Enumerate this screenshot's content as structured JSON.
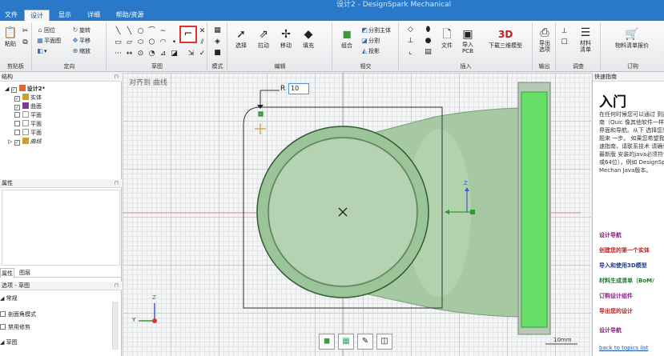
{
  "app_title": "设计2 - DesignSpark Mechanical",
  "tabs": [
    "文件",
    "设计",
    "显示",
    "详细",
    "帮助/资源"
  ],
  "ribbon": {
    "clipboard": {
      "paste": "粘贴",
      "label": "剪贴板"
    },
    "orient": {
      "home": "回位",
      "plan": "平面图",
      "rotate": "旋转",
      "pan": "平移",
      "zoom": "缩放",
      "label": "定向"
    },
    "sketch_label": "草图",
    "mode_label": "模式",
    "edit": {
      "select": "选择",
      "pull": "拉动",
      "move": "移动",
      "fill": "填充",
      "label": "编辑"
    },
    "intersect": {
      "combine": "组合",
      "split_body": "分割主体",
      "split": "分割",
      "project": "投影",
      "label": "相交"
    },
    "insert": {
      "file": "文件",
      "import_pcb": "导入\nPCB",
      "download_3d": "下载三维模型",
      "label": "插入"
    },
    "output": {
      "export_options": "导出\n选项",
      "label": "输出"
    },
    "investigate": {
      "material_list": "材料\n清单",
      "label": "调查"
    },
    "order": {
      "bom_quote": "物料清单报价",
      "label": "订购"
    }
  },
  "structure": {
    "header": "结构",
    "design_name": "设计2*",
    "items": [
      "实体",
      "曲面",
      "平面",
      "平面",
      "平面",
      "曲线"
    ]
  },
  "properties": {
    "header": "属性"
  },
  "bottom_tabs": [
    "属性",
    "图层"
  ],
  "options": {
    "header": "选项 - 草图",
    "general": "常规",
    "chk1": "剖面角模式",
    "chk2": "禁用修剪",
    "section2": "草图"
  },
  "canvas": {
    "title": "对齐到 曲线",
    "radius_label": "R",
    "radius_value": "10",
    "scale_label": "10mm",
    "axis_y": "Y",
    "axis_z": "Z"
  },
  "guide": {
    "header": "快速指南",
    "title": "入门",
    "body": "在任何时候您可以通过 到这个快速指南（Quic 像其他软件一样，需要 用户界面和导航。从下 选择您感兴趣的话题来 一步。 如果您希望我们添加其 快速指南，请联系技术 请确认您有安装最新版 安装的java必须符合该 （32位或64位），例如 DesignSpark Mechan Java版本。",
    "links": [
      "设计导航",
      "创建您的第一个实体",
      "导入和使用3D模型",
      "材料生成清单（BoM/",
      "订购设计组件",
      "导出您的设计",
      "设计导航",
      "back to topics list"
    ],
    "link_colors": [
      "#8b1a8b",
      "#c0211f",
      "#1a3c8b",
      "#1a7a2a",
      "#8b1a8b",
      "#c0211f",
      "#8b1a8b",
      "#1a56b0"
    ]
  },
  "colors": {
    "accent": "#2a78c8",
    "solid": "#8fc98a",
    "solid_face": "#66e066"
  }
}
